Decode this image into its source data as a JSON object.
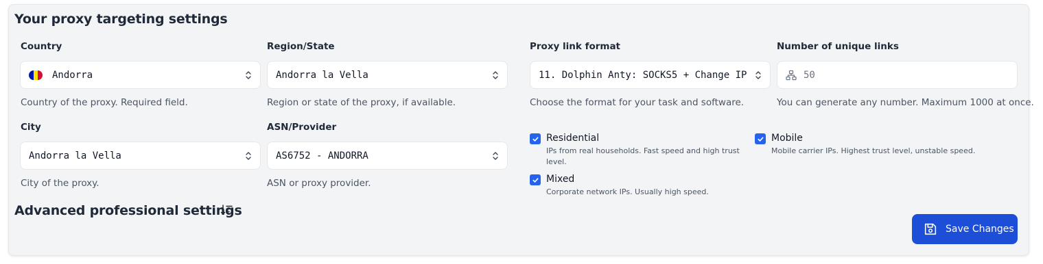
{
  "section": {
    "title": "Your proxy targeting settings",
    "advanced_title": "Advanced professional settings"
  },
  "country": {
    "label": "Country",
    "value": "Andorra",
    "help": "Country of the proxy. Required field.",
    "flag_colors": [
      "#0018A8",
      "#FEDF00",
      "#D0103A"
    ]
  },
  "region": {
    "label": "Region/State",
    "value": "Andorra la Vella",
    "help": "Region or state of the proxy, if available."
  },
  "city": {
    "label": "City",
    "value": "Andorra la Vella",
    "help": "City of the proxy."
  },
  "asn": {
    "label": "ASN/Provider",
    "value": "AS6752 - ANDORRA",
    "help": "ASN or proxy provider."
  },
  "link_format": {
    "label": "Proxy link format",
    "value": "11. Dolphin Anty: SOCKS5 + Change IP",
    "help": "Choose the format for your task and software."
  },
  "unique_links": {
    "label": "Number of unique links",
    "value": "50",
    "help": "You can generate any number. Maximum 1000 at once.",
    "icon": "network-icon"
  },
  "types": [
    {
      "label": "Residential",
      "desc_line1": "IPs from real households. Fast speed and high trust",
      "desc_line2": "level.",
      "checked": true
    },
    {
      "label": "Mobile",
      "desc_line1": "Mobile carrier IPs. Highest trust level, unstable speed.",
      "checked": true
    },
    {
      "label": "Mixed",
      "desc_line1": "Corporate network IPs. Usually high speed.",
      "checked": true
    }
  ],
  "save_button": {
    "label": "Save Changes",
    "icon": "save-icon"
  },
  "colors": {
    "accent": "#2563eb",
    "button": "#1d4ed8",
    "panel": "#f3f4f6"
  }
}
